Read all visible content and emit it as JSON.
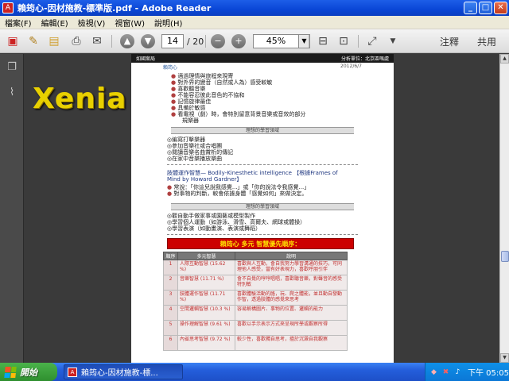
{
  "window": {
    "title": "賴筠心-因材施教-標準版.pdf - Adobe Reader",
    "controls": {
      "minimize": "_",
      "maximize": "□",
      "close": "✕"
    }
  },
  "menu": {
    "items": [
      "檔案(F)",
      "編輯(E)",
      "檢視(V)",
      "視窗(W)",
      "說明(H)"
    ]
  },
  "toolbar": {
    "page_current": "14",
    "page_total": "/ 20",
    "zoom": "45%",
    "comment_label": "注釋",
    "share_label": "共用"
  },
  "watermark": {
    "text": "Xenia"
  },
  "document": {
    "header_left": "如國案局",
    "header_right": "分析單位：北京區嗎處",
    "name_line": "賴筠心",
    "date": "2012/6/7",
    "bullets": [
      "適過理情與旅程來現寄",
      "對外界的變音（自然或人為）感受較敏",
      "喜歡聽音樂",
      "不能容忍彼此音色的不協和",
      "記憶旋律最佳",
      "具備於敏感",
      "看電視（劇）時，會特別留意背景音樂或音效的部分",
      "規樂器"
    ],
    "section1_title": "理想的學習領域",
    "section1_items": [
      "◎編寫打擊樂器",
      "◎參加音樂社或合唱團",
      "◎閱讀音樂名曲賞析的傳記",
      "◎在家中音樂播放樂曲"
    ],
    "intel_title_1": "肢體運作智慧— Bodily-Kinesthetic intelligence 【根據Frames of",
    "intel_title_2": "Mind by Howard Gardner】",
    "intel_lines": [
      "常說：「你這兒說我感覺...」或「你的說法令我感覺...」",
      "對事物的判斷，較會依據身體「感覺如何」來做決定。"
    ],
    "section2_title": "理想的學習領域",
    "section2_items": [
      "◎觀自動手做家事或園藝或模型製作",
      "◎學習個人運動（如游泳、滑雪、高爾夫、網球或體操）",
      "◎學習表演（如動畫演、表演或舞蹈）"
    ],
    "banner": "賴筠心 多元 智慧優先順序：",
    "table": {
      "headers": [
        "順序",
        "多元智慧",
        "說明"
      ],
      "rows": [
        {
          "rank": "1",
          "name": "人際互動智慧 (15.62 %)",
          "desc": "喜歡與人互動，會自我努力學習溝通的技巧，可同理他人感受，當有好表現力，喜歡呼朋引伴"
        },
        {
          "rank": "2",
          "name": "音樂智慧 (11.71 %)",
          "desc": "會不自覺的哼哼唱唱，喜歡聽音樂，對聲音的感受特別敏"
        },
        {
          "rank": "3",
          "name": "肢體運作智慧 (11.71 %)",
          "desc": "喜歡體驗活動的胳，玩、爬之體能，並且動自發動作智，透過肢體的感覺來思考"
        },
        {
          "rank": "4",
          "name": "空間邏輯智慧 (10.3 %)",
          "desc": "容易解構圖片、事物的位置、邏輯的能力"
        },
        {
          "rank": "5",
          "name": "操作理解智慧 (9.61 %)",
          "desc": "喜歡以手示表示方式來呈現所學或觀察所得"
        },
        {
          "rank": "6",
          "name": "內省思考智慧 (9.72 %)",
          "desc": "較少性，喜歡獨自思考，擅於沉澱自我觀察"
        }
      ]
    }
  },
  "taskbar": {
    "start_label": "開始",
    "task_label": "賴筠心-因材施教-標...",
    "clock": "下午 05:05"
  },
  "colors": {
    "titlebar": "#0a46d6",
    "banner_bg": "#cc0000",
    "banner_text": "#ffe000",
    "watermark": "#e8d000"
  }
}
